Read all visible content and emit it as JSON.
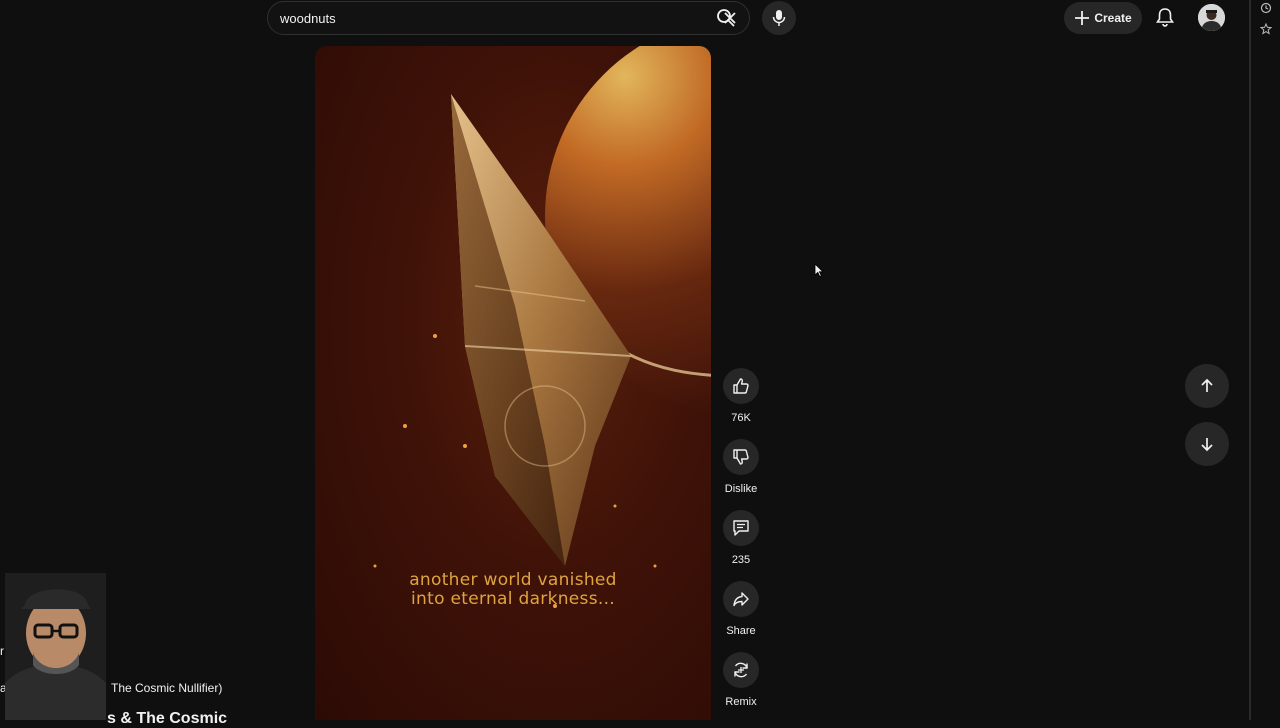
{
  "search": {
    "query": "woodnuts"
  },
  "header": {
    "create_label": "Create"
  },
  "short": {
    "caption_line1": "another world vanished",
    "caption_line2": "into eternal darkness...",
    "like_count": "76K",
    "dislike_label": "Dislike",
    "comment_count": "235",
    "share_label": "Share",
    "remix_label": "Remix"
  },
  "overlay": {
    "partial_title": "The Cosmic Nullifier)",
    "partial_heading": "s & The Cosmic",
    "edge_text_a": "r",
    "edge_text_b": "al"
  },
  "colors": {
    "background": "#0f0f0f",
    "caption": "#e0a43e",
    "button_bg": "#272727"
  },
  "icons": [
    "x-icon",
    "search-icon",
    "microphone-icon",
    "plus-icon",
    "bell-icon",
    "thumbs-up-icon",
    "thumbs-down-icon",
    "comment-icon",
    "share-icon",
    "remix-icon",
    "arrow-up-icon",
    "arrow-down-icon",
    "clock-icon",
    "star-icon"
  ]
}
